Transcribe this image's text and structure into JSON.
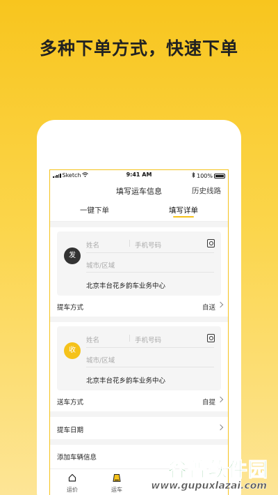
{
  "headline": "多种下单方式，快速下单",
  "status_bar": {
    "carrier": "Sketch",
    "time": "9:41 AM",
    "battery": "100%"
  },
  "nav": {
    "title": "填写运车信息",
    "history": "历史线路"
  },
  "tabs": [
    {
      "label": "一键下单"
    },
    {
      "label": "填写详单"
    }
  ],
  "sender": {
    "badge": "发",
    "name_placeholder": "姓名",
    "phone_placeholder": "手机号码",
    "city_placeholder": "城市/区域",
    "address": "北京丰台花乡韵车业务中心",
    "pickup_label": "提车方式",
    "pickup_value": "自送"
  },
  "receiver": {
    "badge": "收",
    "name_placeholder": "姓名",
    "phone_placeholder": "手机号码",
    "city_placeholder": "城市/区域",
    "address": "北京丰台花乡韵车业务中心",
    "delivery_label": "送车方式",
    "delivery_value": "自提"
  },
  "pickup_date_label": "提车日期",
  "add_vehicle_label": "添加车辆信息",
  "tabbar": [
    {
      "label": "运价",
      "icon": "home-icon"
    },
    {
      "label": "运车",
      "icon": "car-icon"
    }
  ],
  "watermark": {
    "title": "谷普软件园",
    "url": "www.gupuxlazai.com"
  },
  "colors": {
    "accent": "#f5c21a",
    "sender_badge": "#333333",
    "receiver_badge": "#f5c21a",
    "watermark_green": "#1a9a3a"
  }
}
